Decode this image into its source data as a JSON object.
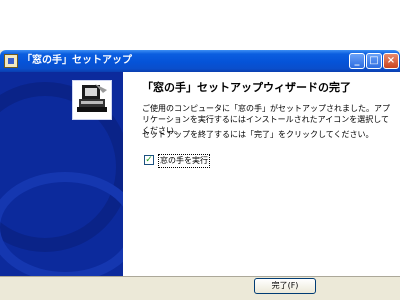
{
  "window": {
    "title": "「窓の手」セットアップ",
    "controls": {
      "minimize": "_",
      "maximize": "□",
      "close": "×"
    }
  },
  "wizard": {
    "heading": "「窓の手」セットアップウィザードの完了",
    "message1": "ご使用のコンピュータに「窓の手」がセットアップされました。アプリケーションを実行するにはインストールされたアイコンを選択してください。",
    "message2": "セットアップを終了するには「完了」をクリックしてください。",
    "checkbox": {
      "label": "窓の手を実行",
      "checked": true,
      "mark": "✓"
    }
  },
  "buttons": {
    "finish": "完了(F)"
  },
  "colors": {
    "titlebar": "#0553d8",
    "sidebar": "#0c2a9c",
    "dialog": "#ece9d8"
  }
}
